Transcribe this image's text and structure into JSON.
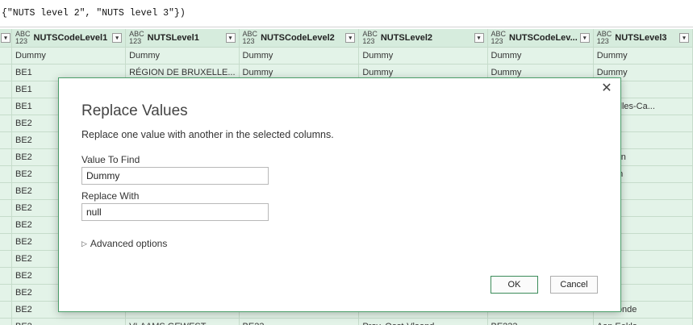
{
  "formula": "{\"NUTS level 2\", \"NUTS level 3\"})",
  "grid": {
    "type_icon_top": "ABC",
    "type_icon_bottom": "123",
    "lead_btn": "▾",
    "columns": [
      {
        "name": "NUTSCodeLevel1"
      },
      {
        "name": "NUTSLevel1"
      },
      {
        "name": "NUTSCodeLevel2"
      },
      {
        "name": "NUTSLevel2"
      },
      {
        "name": "NUTSCodeLev..."
      },
      {
        "name": "NUTSLevel3"
      }
    ],
    "rows": [
      [
        "Dummy",
        "Dummy",
        "Dummy",
        "Dummy",
        "Dummy",
        "Dummy"
      ],
      [
        "BE1",
        "RÉGION DE BRUXELLE...",
        "Dummy",
        "Dummy",
        "Dummy",
        "Dummy"
      ],
      [
        "BE1",
        "",
        "",
        "",
        "",
        ""
      ],
      [
        "BE1",
        "",
        "",
        "",
        "",
        "Bruxelles-Ca..."
      ],
      [
        "BE2",
        "",
        "",
        "",
        "",
        ""
      ],
      [
        "BE2",
        "",
        "",
        "",
        "",
        ""
      ],
      [
        "BE2",
        "",
        "",
        "",
        "",
        "werpen"
      ],
      [
        "BE2",
        "",
        "",
        "",
        "",
        "chelen"
      ],
      [
        "BE2",
        "",
        "",
        "",
        "",
        "nhout"
      ],
      [
        "BE2",
        "",
        "",
        "",
        "",
        ""
      ],
      [
        "BE2",
        "",
        "",
        "",
        "",
        "selt"
      ],
      [
        "BE2",
        "",
        "",
        "",
        "",
        "aseik"
      ],
      [
        "BE2",
        "",
        "",
        "",
        "",
        "geren"
      ],
      [
        "BE2",
        "",
        "",
        "",
        "",
        ""
      ],
      [
        "BE2",
        "",
        "",
        "",
        "",
        "st"
      ],
      [
        "BE2",
        "",
        "",
        "",
        "",
        "dermonde"
      ],
      [
        "BE2",
        "VLAAMS GEWEST",
        "BE23",
        "Prov. Oost-Vlaand...",
        "BE233",
        "Aan Eeklo"
      ]
    ]
  },
  "dialog": {
    "title": "Replace Values",
    "description": "Replace one value with another in the selected columns.",
    "find_label": "Value To Find",
    "find_value": "Dummy",
    "replace_label": "Replace With",
    "replace_value": "null",
    "advanced_label": "Advanced options",
    "advanced_icon": "▷",
    "close_icon": "✕",
    "ok_label": "OK",
    "cancel_label": "Cancel"
  }
}
